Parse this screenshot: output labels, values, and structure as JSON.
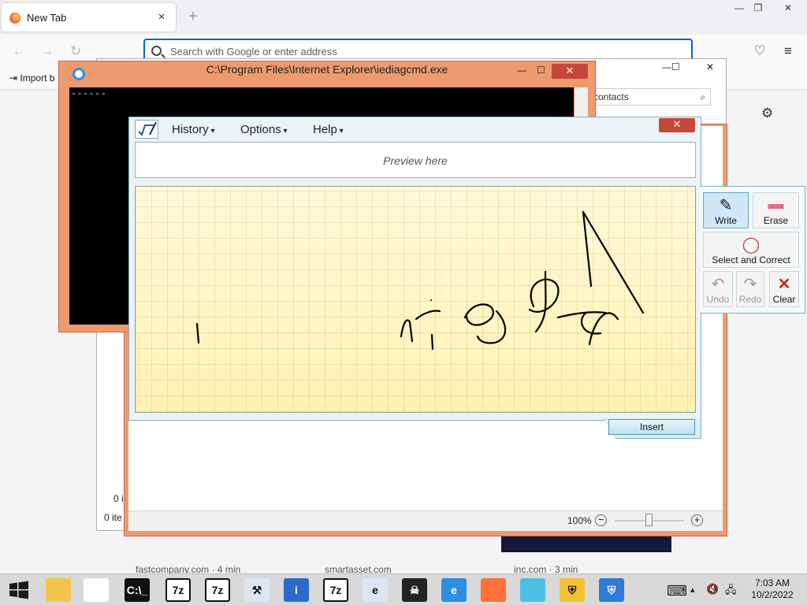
{
  "firefox": {
    "tab_title": "New Tab",
    "tab_close": "×",
    "new_tab": "+",
    "url_placeholder": "Search with Google or enter address",
    "import_label": "Import b",
    "win_min": "—",
    "win_max": "❐",
    "win_close": "✕",
    "back": "←",
    "forward": "→",
    "reload": "↻",
    "pocket": "♡",
    "menu": "≡"
  },
  "back_window": {
    "search_placeholder": "contacts",
    "side_count_1": "0 i",
    "side_count_2": "0 ite",
    "min": "—",
    "max": "☐",
    "close": "✕",
    "gear": "⚙"
  },
  "cmd_window": {
    "title": "C:\\Program Files\\Internet Explorer\\iediagcmd.exe",
    "cursor_text": "------",
    "min": "—",
    "max": "☐",
    "close": "✕"
  },
  "tip": {
    "menus": [
      "History",
      "Options",
      "Help"
    ],
    "close": "✕",
    "preview_placeholder": "Preview here",
    "insert": "Insert",
    "tools": {
      "write": "Write",
      "erase": "Erase",
      "select": "Select and Correct",
      "undo": "Undo",
      "redo": "Redo",
      "clear": "Clear"
    }
  },
  "status": {
    "zoom": "100%",
    "minus": "−",
    "plus": "+"
  },
  "snippets": [
    "fastcompany.com · 4 min",
    "smartasset.com",
    "inc.com · 3 min"
  ],
  "taskbar": {
    "apps": [
      {
        "name": "file-explorer-icon",
        "glyph": "",
        "color": "#f3c64b"
      },
      {
        "name": "chrome-icon",
        "glyph": "",
        "color": "#ffffff"
      },
      {
        "name": "command-prompt-icon",
        "glyph": "C:\\_",
        "color": "#111111"
      },
      {
        "name": "7zip-icon",
        "glyph": "7z",
        "color": "#ffffff"
      },
      {
        "name": "7zip-icon-2",
        "glyph": "7z",
        "color": "#ffffff"
      },
      {
        "name": "tools-icon",
        "glyph": "⚒",
        "color": "#dbe6f2"
      },
      {
        "name": "system-info-icon",
        "glyph": "i",
        "color": "#2b6ac9"
      },
      {
        "name": "7zip-error-icon",
        "glyph": "7z",
        "color": "#ffffff"
      },
      {
        "name": "ie-diagnostics-icon",
        "glyph": "e",
        "color": "#dbe6f2"
      },
      {
        "name": "bug-icon",
        "glyph": "☠",
        "color": "#222222"
      },
      {
        "name": "internet-explorer-icon",
        "glyph": "e",
        "color": "#2d8ee3"
      },
      {
        "name": "firefox-icon",
        "glyph": "",
        "color": "#ff7139"
      },
      {
        "name": "shell-icon",
        "glyph": "",
        "color": "#4ec0e6"
      },
      {
        "name": "shield-icon",
        "glyph": "⛨",
        "color": "#f2c230"
      },
      {
        "name": "shield-icon-2",
        "glyph": "⛨",
        "color": "#2f7bd6"
      }
    ],
    "time": "7:03 AM",
    "date": "10/2/2022",
    "keyboard": "⌨",
    "chevron": "▴",
    "volume": "🔇",
    "network": "🖧"
  }
}
